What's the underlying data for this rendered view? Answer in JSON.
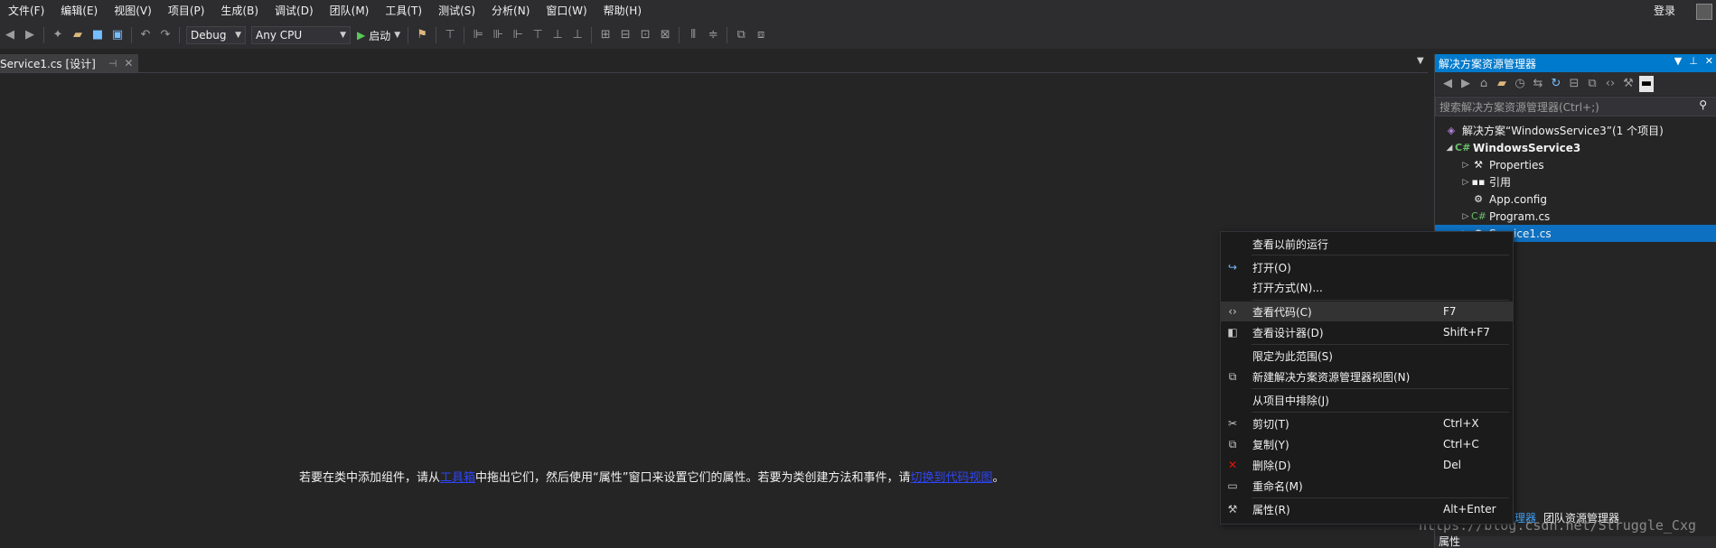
{
  "menu": {
    "items": [
      "文件(F)",
      "编辑(E)",
      "视图(V)",
      "项目(P)",
      "生成(B)",
      "调试(D)",
      "团队(M)",
      "工具(T)",
      "测试(S)",
      "分析(N)",
      "窗口(W)",
      "帮助(H)"
    ],
    "login": "登录"
  },
  "toolbar": {
    "config": "Debug",
    "platform": "Any CPU",
    "start_label": "启动"
  },
  "document": {
    "tab_title": "Service1.cs [设计]",
    "hint_before": "若要在类中添加组件，请从",
    "hint_link1": "工具箱",
    "hint_middle": "中拖出它们，然后使用“属性”窗口来设置它们的属性。若要为类创建方法和事件，请",
    "hint_link2": "切换到代码视图",
    "hint_end": "。"
  },
  "solution_explorer": {
    "title": "解决方案资源管理器",
    "search_placeholder": "搜索解决方案资源管理器(Ctrl+;)",
    "tree": {
      "solution": "解决方案“WindowsService3”(1 个项目)",
      "project": "WindowsService3",
      "properties": "Properties",
      "references": "引用",
      "appconfig": "App.config",
      "program": "Program.cs",
      "service": "Service1.cs"
    },
    "bottom_tabs": [
      "解决方案资源管理器",
      "团队资源管理器"
    ],
    "properties_title": "属性"
  },
  "context_menu": {
    "items": [
      {
        "label": "查看以前的运行",
        "shortcut": "",
        "icon": "history-icon"
      },
      {
        "label": "打开(O)",
        "shortcut": "",
        "icon": "open-arrow-icon"
      },
      {
        "label": "打开方式(N)...",
        "shortcut": "",
        "icon": ""
      },
      {
        "label": "查看代码(C)",
        "shortcut": "F7",
        "icon": "code-brackets-icon"
      },
      {
        "label": "查看设计器(D)",
        "shortcut": "Shift+F7",
        "icon": "designer-icon"
      },
      {
        "label": "限定为此范围(S)",
        "shortcut": "",
        "icon": ""
      },
      {
        "label": "新建解决方案资源管理器视图(N)",
        "shortcut": "",
        "icon": "new-view-icon"
      },
      {
        "label": "从项目中排除(J)",
        "shortcut": "",
        "icon": ""
      },
      {
        "label": "剪切(T)",
        "shortcut": "Ctrl+X",
        "icon": "scissors-icon"
      },
      {
        "label": "复制(Y)",
        "shortcut": "Ctrl+C",
        "icon": "copy-icon"
      },
      {
        "label": "删除(D)",
        "shortcut": "Del",
        "icon": "delete-x-icon"
      },
      {
        "label": "重命名(M)",
        "shortcut": "",
        "icon": "rename-icon"
      },
      {
        "label": "属性(R)",
        "shortcut": "Alt+Enter",
        "icon": "wrench-icon"
      }
    ]
  },
  "watermark": "https://blog.csdn.net/Struggle_Cxg",
  "colors": {
    "accent": "#007acc",
    "selection": "#0e70c0",
    "link": "#2f45f6",
    "background": "#252526",
    "chrome": "#2d2d30"
  }
}
